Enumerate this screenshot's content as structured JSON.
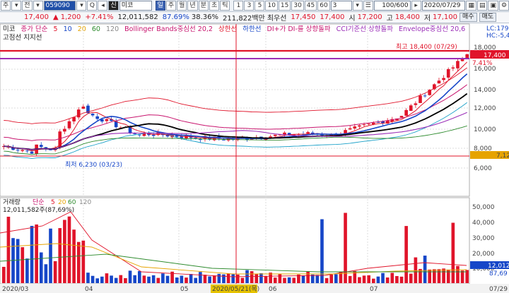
{
  "toolbar": {
    "menu_label": "주",
    "jeon_label": "전",
    "code": "059090",
    "sin_label": "신",
    "stock_name": "미코",
    "periods": [
      "일",
      "주",
      "월",
      "년",
      "분",
      "초",
      "틱"
    ],
    "active_period": "일",
    "minute_options": [
      "1",
      "3",
      "5",
      "10",
      "15",
      "30",
      "45",
      "60"
    ],
    "minute_field": "3",
    "count_field": "100/600",
    "date": "2020/07/29",
    "buy_label": "매수",
    "sell_label": "매도"
  },
  "info": {
    "price": "17,400",
    "change_arrow": "▲",
    "change": "1,200",
    "change_pct": "+7.41%",
    "volume": "12,011,582",
    "vol_ratio": "87.69%",
    "turnover": "38.36%",
    "amount": "211,822백만",
    "min_label": "최우선",
    "ask": "17,450",
    "bid": "17,400",
    "open_label": "시",
    "open": "17,200",
    "high_label": "고",
    "high": "18,400",
    "low_label": "저",
    "low": "17,100",
    "buy_btn": "매수",
    "sell_btn": "매도"
  },
  "legend": {
    "title": "미코",
    "ma_title": "종가 단순",
    "ma_periods": [
      "5",
      "10",
      "20",
      "60",
      "120"
    ],
    "bb": "Bollinger Bands중심선 20,2",
    "upper": "상한선",
    "lower": "하한선",
    "di": "DI+가 DI-를 상향돌파",
    "cci": "CCI기준선 상향돌파",
    "env": "Envelope중심선 20,6",
    "lc": "LC:179",
    "hc": "HC:-5,4",
    "line2": "고점선  지지선"
  },
  "vol_legend": {
    "title": "거래량",
    "ma_title": "단순",
    "ma_periods": [
      "5",
      "20",
      "60",
      "120"
    ],
    "value": "12,011,582주(87,69%)"
  },
  "annotations": {
    "max": "최고 18,400 (07/29)",
    "min": "최저 6,230 (03/23)"
  },
  "price_axis": {
    "ticks": [
      "18,000",
      "16,000",
      "14,000",
      "12,000",
      "10,000",
      "8,000",
      "6,000"
    ],
    "current": "17,400",
    "current_pct": "7.41%",
    "ref": "7,12"
  },
  "vol_axis": {
    "ticks": [
      "50,000",
      "40,000",
      "30,000",
      "20,000",
      "10,000"
    ],
    "current": "12,012",
    "pct": "87,69"
  },
  "date_axis": {
    "labels": [
      "2020/03",
      "04",
      "05",
      "2020/05/21(목)",
      "06",
      "07",
      "07/29"
    ]
  },
  "colors": {
    "up": "#e0142a",
    "down": "#1646c8",
    "ma5": "#e0142a",
    "ma10": "#1646c8",
    "ma20": "#e6a300",
    "ma60": "#2e8b2e",
    "ma120": "#888888",
    "bb": "#c8146e",
    "env": "#9b2fb8"
  }
}
